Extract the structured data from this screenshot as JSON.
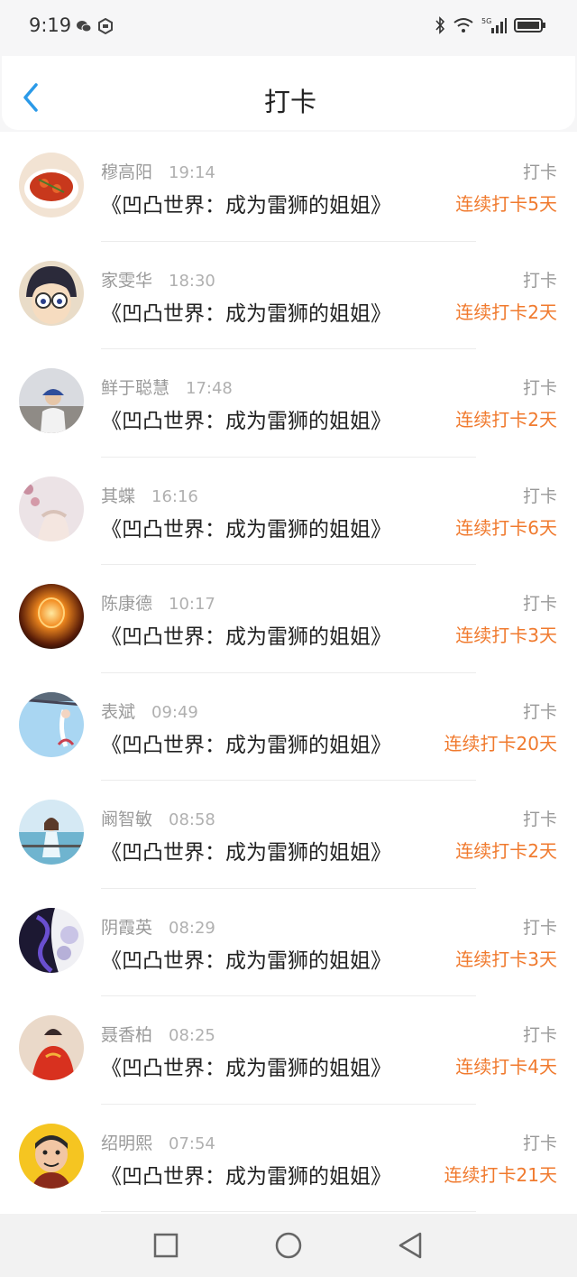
{
  "status_bar": {
    "time": "9:19",
    "icons": [
      "wechat-icon",
      "app-badge-icon",
      "bluetooth-icon",
      "wifi-icon",
      "signal-5g-icon",
      "battery-icon"
    ]
  },
  "header": {
    "title": "打卡",
    "back_icon": "chevron-left-icon",
    "accent_color": "#2b9ae8"
  },
  "colors": {
    "streak": "#f07a2e",
    "muted": "#9a9a9a"
  },
  "checkins": [
    {
      "name": "穆高阳",
      "time": "19:14",
      "book": "《凹凸世界：成为雷狮的姐姐》",
      "tag": "打卡",
      "streak": "连续打卡5天",
      "avatar": "food-avatar"
    },
    {
      "name": "家雯华",
      "time": "18:30",
      "book": "《凹凸世界：成为雷狮的姐姐》",
      "tag": "打卡",
      "streak": "连续打卡2天",
      "avatar": "cartoon-boy-glasses-avatar"
    },
    {
      "name": "鲜于聪慧",
      "time": "17:48",
      "book": "《凹凸世界：成为雷狮的姐姐》",
      "tag": "打卡",
      "streak": "连续打卡2天",
      "avatar": "photo-person-avatar"
    },
    {
      "name": "其蝶",
      "time": "16:16",
      "book": "《凹凸世界：成为雷狮的姐姐》",
      "tag": "打卡",
      "streak": "连续打卡6天",
      "avatar": "hands-avatar"
    },
    {
      "name": "陈康德",
      "time": "10:17",
      "book": "《凹凸世界：成为雷狮的姐姐》",
      "tag": "打卡",
      "streak": "连续打卡3天",
      "avatar": "light-bulb-avatar"
    },
    {
      "name": "表斌",
      "time": "09:49",
      "book": "《凹凸世界：成为雷狮的姐姐》",
      "tag": "打卡",
      "streak": "连续打卡20天",
      "avatar": "blue-sky-avatar"
    },
    {
      "name": "阚智敏",
      "time": "08:58",
      "book": "《凹凸世界：成为雷狮的姐姐》",
      "tag": "打卡",
      "streak": "连续打卡2天",
      "avatar": "seaside-girl-avatar"
    },
    {
      "name": "阴霞英",
      "time": "08:29",
      "book": "《凹凸世界：成为雷狮的姐姐》",
      "tag": "打卡",
      "streak": "连续打卡3天",
      "avatar": "dark-art-avatar"
    },
    {
      "name": "聂香柏",
      "time": "08:25",
      "book": "《凹凸世界：成为雷狮的姐姐》",
      "tag": "打卡",
      "streak": "连续打卡4天",
      "avatar": "red-dress-avatar"
    },
    {
      "name": "绍明熙",
      "time": "07:54",
      "book": "《凹凸世界：成为雷狮的姐姐》",
      "tag": "打卡",
      "streak": "连续打卡21天",
      "avatar": "cartoon-man-avatar"
    }
  ],
  "nav_bar": {
    "icons": [
      "square-recents-icon",
      "circle-home-icon",
      "triangle-back-icon"
    ]
  }
}
